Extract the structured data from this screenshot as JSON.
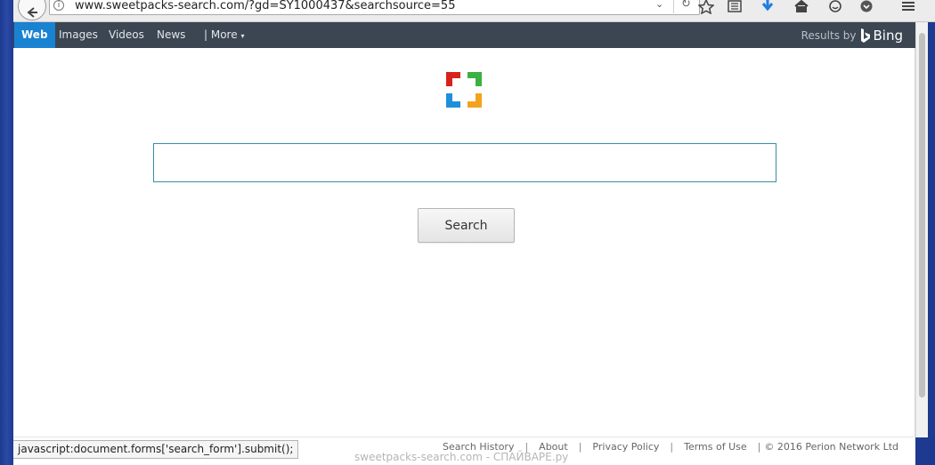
{
  "browser": {
    "url": "www.sweetpacks-search.com/?gd=SY1000437&searchsource=55",
    "icons": [
      "back-arrow-icon",
      "info-icon",
      "dropdown-icon",
      "reload-icon",
      "star-icon",
      "reading-list-icon",
      "download-icon",
      "home-icon",
      "emoji-icon",
      "pocket-icon",
      "menu-icon"
    ]
  },
  "nav": {
    "web": "Web",
    "images": "Images",
    "videos": "Videos",
    "news": "News",
    "more": "| More",
    "more_arrow": "▾",
    "results_by": "Results by",
    "bing": "Bing"
  },
  "search": {
    "input_value": "",
    "button_label": "Search"
  },
  "footer": {
    "search_history": "Search History",
    "about": "About",
    "privacy": "Privacy Policy",
    "terms": "Terms of Use",
    "copyright": "© 2016 Perion Network Ltd",
    "separator": "|"
  },
  "status_text": "javascript:document.forms['search_form'].submit();",
  "watermark": "sweetpacks-search.com - СПАЙВАРЕ.ру",
  "colors": {
    "nav_bg": "#3b4652",
    "web_tab": "#1982d1",
    "logo_red": "#d6221b",
    "logo_green": "#3cb043",
    "logo_blue": "#1e8fdb",
    "logo_orange": "#f4a21d"
  }
}
